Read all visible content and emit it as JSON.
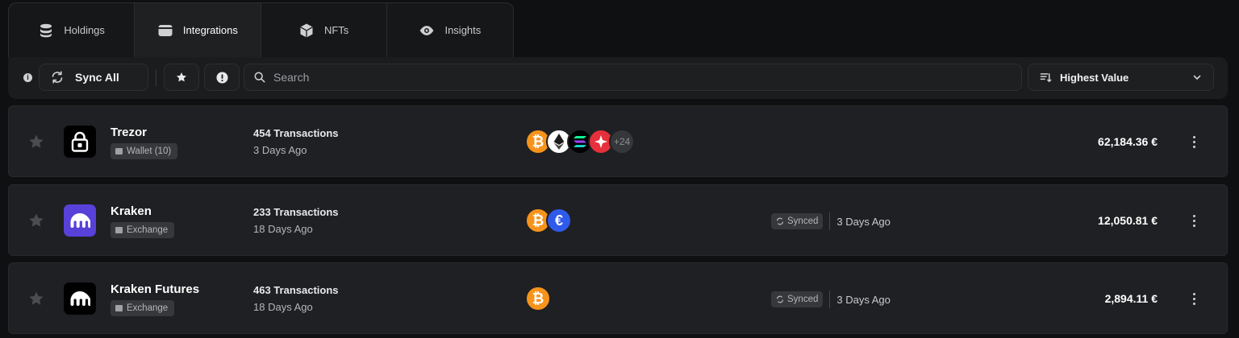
{
  "tabs": [
    {
      "label": "Holdings",
      "icon": "database-icon"
    },
    {
      "label": "Integrations",
      "icon": "wallet-icon",
      "active": true
    },
    {
      "label": "NFTs",
      "icon": "cube-icon"
    },
    {
      "label": "Insights",
      "icon": "eye-icon"
    }
  ],
  "toolbar": {
    "info_glyph": "i",
    "sync_label": "Sync All",
    "search_placeholder": "Search",
    "sort_label": "Highest Value"
  },
  "integrations": [
    {
      "name": "Trezor",
      "badge": "Wallet (10)",
      "transactions": "454 Transactions",
      "last_activity": "3 Days Ago",
      "coins": [
        "bitcoin",
        "ethereum",
        "solana",
        "polkadot"
      ],
      "more_coins": "+24",
      "status": "",
      "status_time": "",
      "value": "62,184.36 €"
    },
    {
      "name": "Kraken",
      "badge": "Exchange",
      "transactions": "233 Transactions",
      "last_activity": "18 Days Ago",
      "coins": [
        "bitcoin",
        "euro"
      ],
      "status": "Synced",
      "status_time": "3 Days Ago",
      "value": "12,050.81 €"
    },
    {
      "name": "Kraken Futures",
      "badge": "Exchange",
      "transactions": "463 Transactions",
      "last_activity": "18 Days Ago",
      "coins": [
        "bitcoin"
      ],
      "status": "Synced",
      "status_time": "3 Days Ago",
      "value": "2,894.11 €"
    }
  ],
  "colors": {
    "bitcoin": "#f7931a",
    "euro": "#2f5bea",
    "kraken_purple": "#5741d9",
    "polkadot_red": "#e6303b"
  }
}
